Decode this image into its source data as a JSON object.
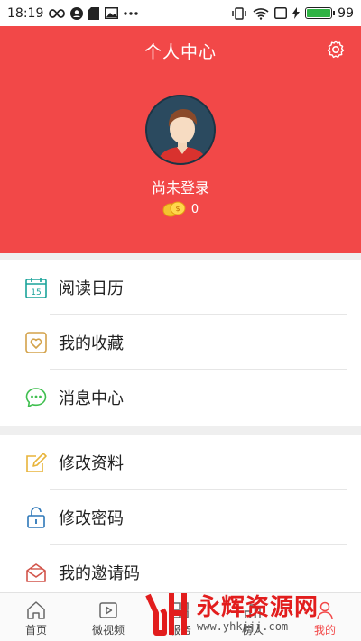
{
  "status_bar": {
    "time": "18:19",
    "battery_level": "99",
    "left_icons": [
      "infinity-icon",
      "account-icon",
      "sd-card-icon",
      "image-icon",
      "more-icon"
    ],
    "right_icons": [
      "vibrate-icon",
      "wifi-icon",
      "sim-icon",
      "charging-icon",
      "battery-icon"
    ]
  },
  "header": {
    "title": "个人中心",
    "username": "尚未登录",
    "coin_count": "0",
    "background_color": "#f24848"
  },
  "menu_group_1": {
    "items": [
      {
        "label": "阅读日历",
        "icon": "calendar-icon",
        "icon_text": "15"
      },
      {
        "label": "我的收藏",
        "icon": "heart-icon"
      },
      {
        "label": "消息中心",
        "icon": "message-icon"
      }
    ]
  },
  "menu_group_2": {
    "items": [
      {
        "label": "修改资料",
        "icon": "edit-icon"
      },
      {
        "label": "修改密码",
        "icon": "lock-icon"
      },
      {
        "label": "我的邀请码",
        "icon": "invite-icon"
      }
    ]
  },
  "tab_bar": {
    "tabs": [
      {
        "label": "首页",
        "icon": "home-icon"
      },
      {
        "label": "微视频",
        "icon": "video-icon"
      },
      {
        "label": "服务",
        "icon": "service-icon"
      },
      {
        "label": "榜人",
        "icon": "ranking-icon"
      },
      {
        "label": "我的",
        "icon": "user-icon"
      }
    ]
  },
  "watermark": {
    "brand": "永辉资源网",
    "url": "www.yhkjjj.com"
  }
}
